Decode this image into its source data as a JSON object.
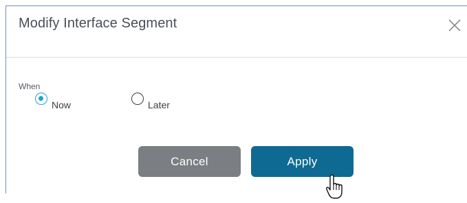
{
  "dialog": {
    "title": "Modify Interface Segment",
    "close_icon": "close-icon",
    "when_label": "When",
    "options": [
      {
        "label": "Now",
        "selected": true
      },
      {
        "label": "Later",
        "selected": false
      }
    ],
    "cancel_label": "Cancel",
    "apply_label": "Apply"
  },
  "colors": {
    "accent": "#1fa0d7",
    "apply_button": "#0e6a93",
    "cancel_button": "#7b7f83",
    "title_text": "#4a4f55"
  },
  "cursor_icon": "hand-pointer-icon"
}
